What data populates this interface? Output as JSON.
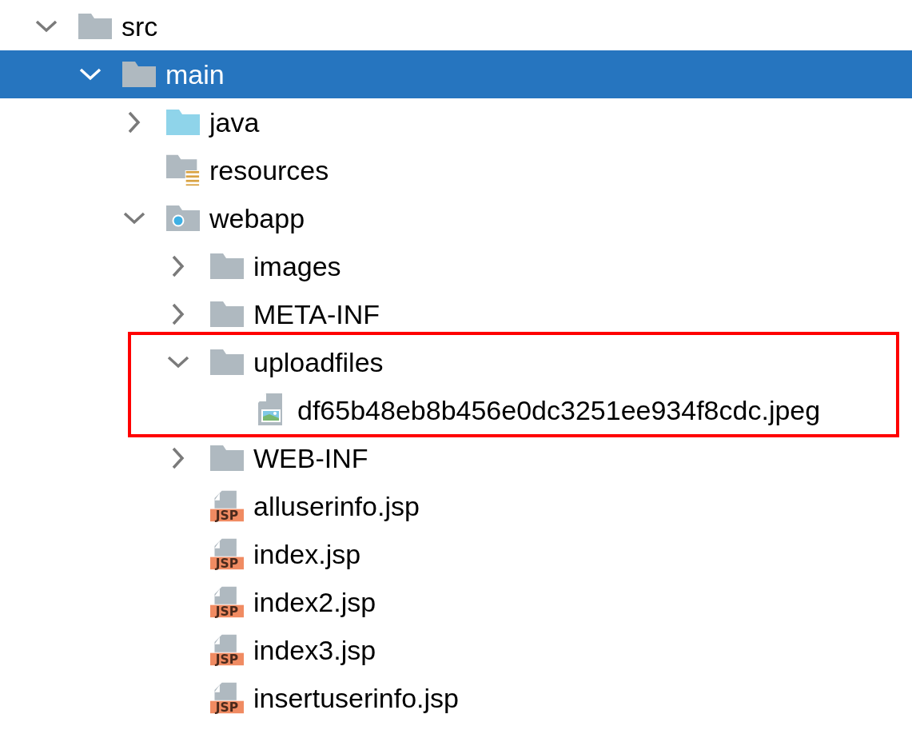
{
  "tree": [
    {
      "label": "src",
      "kind": "folder",
      "expanded": true,
      "selected": false,
      "children": [
        {
          "label": "main",
          "kind": "folder",
          "expanded": true,
          "selected": true,
          "children": [
            {
              "label": "java",
              "kind": "source-folder",
              "expanded": false,
              "selected": false
            },
            {
              "label": "resources",
              "kind": "resources-folder",
              "selected": false
            },
            {
              "label": "webapp",
              "kind": "web-folder",
              "expanded": true,
              "selected": false,
              "children": [
                {
                  "label": "images",
                  "kind": "folder",
                  "expanded": false,
                  "selected": false
                },
                {
                  "label": "META-INF",
                  "kind": "folder",
                  "expanded": false,
                  "selected": false
                },
                {
                  "label": "uploadfiles",
                  "kind": "folder",
                  "expanded": true,
                  "selected": false,
                  "highlighted": true,
                  "children": [
                    {
                      "label": "df65b48eb8b456e0dc3251ee934f8cdc.jpeg",
                      "kind": "image-file",
                      "selected": false
                    }
                  ]
                },
                {
                  "label": "WEB-INF",
                  "kind": "folder",
                  "expanded": false,
                  "selected": false
                },
                {
                  "label": "alluserinfo.jsp",
                  "kind": "jsp-file",
                  "badge": "JSP",
                  "selected": false
                },
                {
                  "label": "index.jsp",
                  "kind": "jsp-file",
                  "badge": "JSP",
                  "selected": false
                },
                {
                  "label": "index2.jsp",
                  "kind": "jsp-file",
                  "badge": "JSP",
                  "selected": false
                },
                {
                  "label": "index3.jsp",
                  "kind": "jsp-file",
                  "badge": "JSP",
                  "selected": false
                },
                {
                  "label": "insertuserinfo.jsp",
                  "kind": "jsp-file",
                  "badge": "JSP",
                  "selected": false
                }
              ]
            }
          ]
        }
      ]
    }
  ]
}
